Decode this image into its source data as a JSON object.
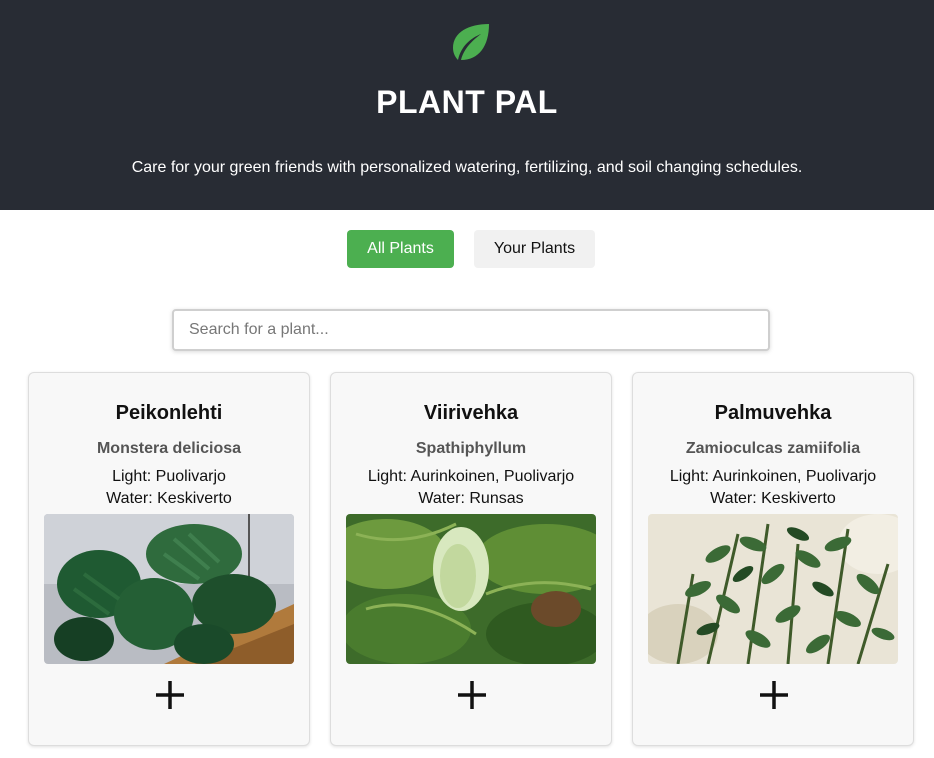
{
  "header": {
    "logo_icon": "leaf-icon",
    "title": "PLANT PAL",
    "tagline": "Care for your green friends with personalized watering, fertilizing, and soil changing schedules."
  },
  "tabs": [
    {
      "label": "All Plants",
      "active": true
    },
    {
      "label": "Your Plants",
      "active": false
    }
  ],
  "search": {
    "placeholder": "Search for a plant...",
    "value": ""
  },
  "plants": [
    {
      "name": "Peikonlehti",
      "scientific": "Monstera deliciosa",
      "light": "Light: Puolivarjo",
      "water": "Water: Keskiverto",
      "add_icon": "plus-icon"
    },
    {
      "name": "Viirivehka",
      "scientific": "Spathiphyllum",
      "light": "Light: Aurinkoinen, Puolivarjo",
      "water": "Water: Runsas",
      "add_icon": "plus-icon"
    },
    {
      "name": "Palmuvehka",
      "scientific": "Zamioculcas zamiifolia",
      "light": "Light: Aurinkoinen, Puolivarjo",
      "water": "Water: Keskiverto",
      "add_icon": "plus-icon"
    }
  ],
  "colors": {
    "header_bg": "#282c34",
    "accent": "#4caf50",
    "leaf": "#4caf50"
  }
}
